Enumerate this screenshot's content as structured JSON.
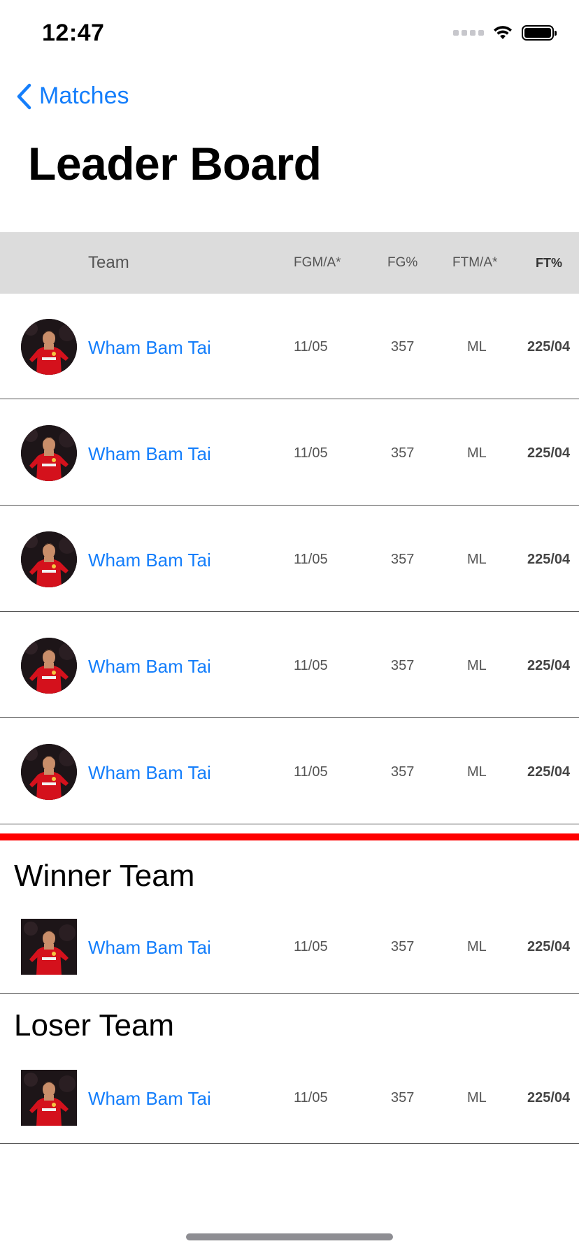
{
  "status_bar": {
    "time": "12:47",
    "icons": [
      "cellular-signal-icon",
      "wifi-icon",
      "battery-icon"
    ]
  },
  "nav": {
    "back_label": "Matches",
    "back_icon": "chevron-left-icon"
  },
  "page": {
    "title": "Leader Board"
  },
  "table": {
    "columns": [
      "Team",
      "FGM/A*",
      "FG%",
      "FTM/A*",
      "FT%"
    ],
    "rows": [
      {
        "name": "Wham Bam Tai",
        "fgma": "11/05",
        "fgp": "357",
        "ftma": "ML",
        "ftp": "225/04"
      },
      {
        "name": "Wham Bam Tai",
        "fgma": "11/05",
        "fgp": "357",
        "ftma": "ML",
        "ftp": "225/04"
      },
      {
        "name": "Wham Bam Tai",
        "fgma": "11/05",
        "fgp": "357",
        "ftma": "ML",
        "ftp": "225/04"
      },
      {
        "name": "Wham Bam Tai",
        "fgma": "11/05",
        "fgp": "357",
        "ftma": "ML",
        "ftp": "225/04"
      },
      {
        "name": "Wham Bam Tai",
        "fgma": "11/05",
        "fgp": "357",
        "ftma": "ML",
        "ftp": "225/04"
      }
    ]
  },
  "winner": {
    "title": "Winner Team",
    "row": {
      "name": "Wham Bam Tai",
      "fgma": "11/05",
      "fgp": "357",
      "ftma": "ML",
      "ftp": "225/04"
    }
  },
  "loser": {
    "title": "Loser Team",
    "row": {
      "name": "Wham Bam Tai",
      "fgma": "11/05",
      "fgp": "357",
      "ftma": "ML",
      "ftp": "225/04"
    }
  },
  "colors": {
    "accent": "#147efb",
    "divider": "#ff0000",
    "header_bg": "#dcdcdc"
  }
}
